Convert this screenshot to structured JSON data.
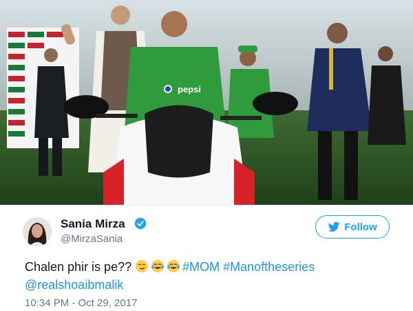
{
  "photo": {
    "jersey_text": "pepsi"
  },
  "tweet": {
    "author_name": "Sania Mirza",
    "author_handle": "@MirzaSania",
    "follow_label": "Follow",
    "text_main": "Chalen phir is pe??",
    "hashtag_mom": "#MOM",
    "hashtag_series": "#Manoftheseries",
    "mention": "@realshoaibmalik",
    "timestamp": "10:34 PM - Oct 29, 2017",
    "emojis": [
      "smirking-face-icon",
      "tears-of-joy-icon",
      "tears-of-joy-icon"
    ]
  },
  "colors": {
    "link_blue": "#1b95e0",
    "follow_blue": "#1da1f2",
    "verified_blue": "#1da1f2",
    "jersey_green": "#2f9b3c"
  }
}
